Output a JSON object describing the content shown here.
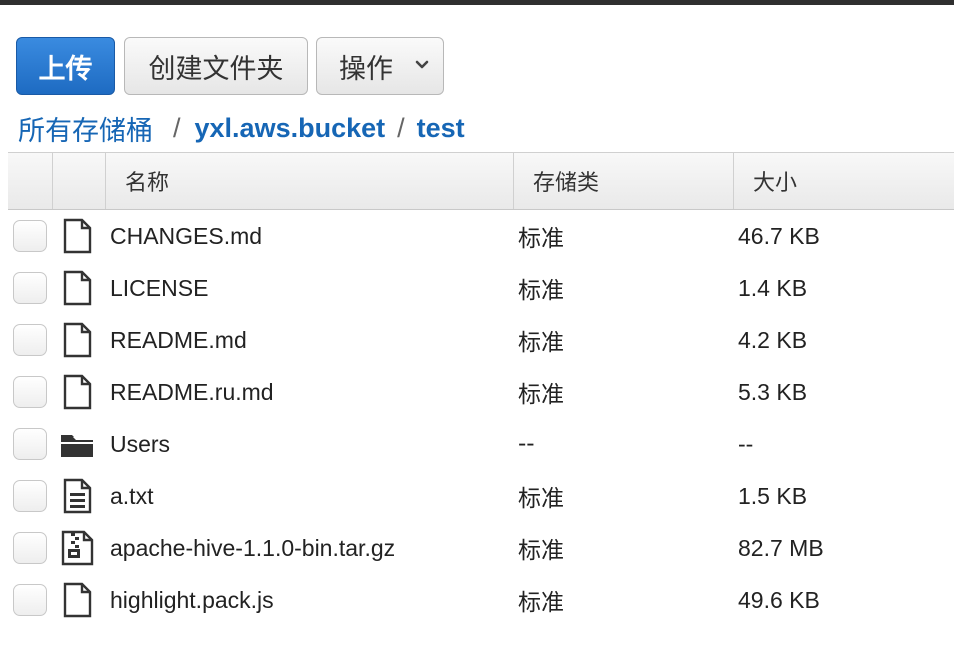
{
  "toolbar": {
    "upload_label": "上传",
    "create_folder_label": "创建文件夹",
    "actions_label": "操作"
  },
  "breadcrumb": {
    "root": "所有存储桶",
    "separator": "/",
    "bucket": "yxl.aws.bucket",
    "folder": "test"
  },
  "table": {
    "headers": {
      "name": "名称",
      "storage_class": "存储类",
      "size": "大小"
    },
    "rows": [
      {
        "name": "CHANGES.md",
        "storage_class": "标准",
        "size": "46.7 KB",
        "icon": "file-icon"
      },
      {
        "name": "LICENSE",
        "storage_class": "标准",
        "size": "1.4 KB",
        "icon": "file-icon"
      },
      {
        "name": "README.md",
        "storage_class": "标准",
        "size": "4.2 KB",
        "icon": "file-icon"
      },
      {
        "name": "README.ru.md",
        "storage_class": "标准",
        "size": "5.3 KB",
        "icon": "file-icon"
      },
      {
        "name": "Users",
        "storage_class": "--",
        "size": "--",
        "icon": "folder-icon"
      },
      {
        "name": "a.txt",
        "storage_class": "标准",
        "size": "1.5 KB",
        "icon": "text-file-icon"
      },
      {
        "name": "apache-hive-1.1.0-bin.tar.gz",
        "storage_class": "标准",
        "size": "82.7 MB",
        "icon": "archive-file-icon"
      },
      {
        "name": "highlight.pack.js",
        "storage_class": "标准",
        "size": "49.6 KB",
        "icon": "file-icon"
      }
    ]
  },
  "colors": {
    "primary_button": "#1e6bc2",
    "link": "#1666b5"
  }
}
